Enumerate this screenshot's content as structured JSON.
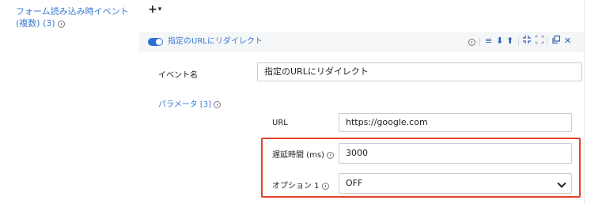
{
  "section": {
    "label": "フォーム読み込み時イベント (複数) (3)",
    "add_label": "+",
    "add_caret": "▾"
  },
  "card": {
    "title": "指定のURLにリダイレクト",
    "toggle_on": true,
    "toolbar": {
      "info_icon": "info-icon",
      "reorder_icon": "≡",
      "move_down_icon": "⬇",
      "move_up_icon": "⬆",
      "collapse_icon": "collapse-icon",
      "expand_icon": "expand-icon",
      "copy_icon": "copy-icon",
      "delete_icon": "✕"
    }
  },
  "event_name": {
    "label": "イベント名",
    "value": "指定のURLにリダイレクト"
  },
  "params": {
    "label": "パラメータ [3]"
  },
  "url": {
    "label": "URL",
    "value": "https://google.com"
  },
  "delay": {
    "label": "遅延時間 (ms)",
    "value": "3000"
  },
  "option1": {
    "label": "オプション 1",
    "value": "OFF"
  },
  "colors": {
    "accent": "#2c6fd6",
    "highlight_border": "#e0462a",
    "link": "#3a7bd5"
  }
}
